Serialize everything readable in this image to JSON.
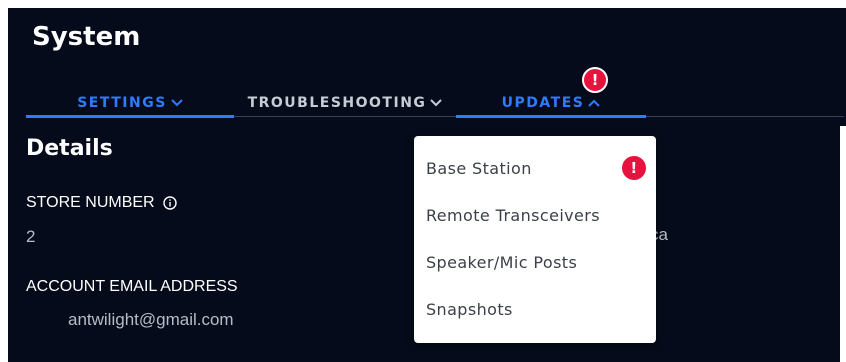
{
  "page": {
    "title": "System"
  },
  "tabs": [
    {
      "label": "SETTINGS",
      "active": false,
      "caret": "chevron-down"
    },
    {
      "label": "TROUBLESHOOTING",
      "active": false,
      "caret": "chevron-down"
    },
    {
      "label": "UPDATES",
      "active": true,
      "caret": "chevron-up"
    }
  ],
  "alerts": {
    "symbol": "!",
    "color": "#e8123f"
  },
  "details": {
    "title": "Details",
    "store_number": {
      "label": "STORE NUMBER",
      "value": "2",
      "icon": "info-icon"
    },
    "account_email": {
      "label": "ACCOUNT EMAIL ADDRESS",
      "value": "antwilight@gmail.com"
    },
    "partial_value": "ca"
  },
  "dropdown": {
    "items": [
      {
        "label": "Base Station",
        "has_alert": true
      },
      {
        "label": "Remote Transceivers",
        "has_alert": false
      },
      {
        "label": "Speaker/Mic Posts",
        "has_alert": false
      },
      {
        "label": "Snapshots",
        "has_alert": false
      }
    ]
  },
  "colors": {
    "background": "#050b1a",
    "accent": "#2f7bff",
    "alert": "#e8123f",
    "dropdown_bg": "#ffffff"
  }
}
